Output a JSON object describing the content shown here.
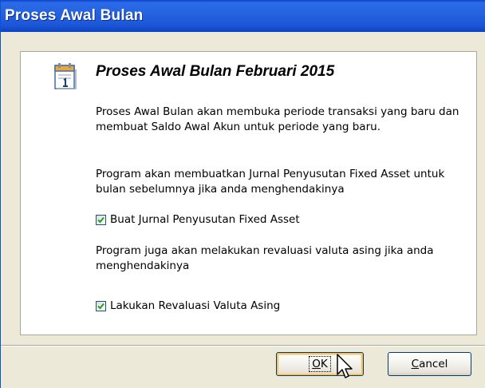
{
  "window": {
    "title": "Proses Awal Bulan"
  },
  "content": {
    "heading": "Proses Awal Bulan Februari 2015",
    "paragraph1": "Proses Awal Bulan akan membuka periode transaksi yang baru dan membuat Saldo Awal Akun untuk periode yang baru.",
    "paragraph2": "Program akan membuatkan Jurnal Penyusutan Fixed Asset untuk bulan sebelumnya jika anda menghendakinya",
    "checkbox1": {
      "label": "Buat Jurnal Penyusutan Fixed Asset",
      "checked": true
    },
    "paragraph3": "Program juga akan melakukan revaluasi valuta asing jika anda menghendakinya",
    "checkbox2": {
      "label": "Lakukan Revaluasi Valuta Asing",
      "checked": true
    }
  },
  "buttons": {
    "ok": {
      "mnemonic": "O",
      "rest": "K"
    },
    "cancel": {
      "mnemonic": "C",
      "rest": "ancel"
    }
  },
  "icons": {
    "document": "calendar-document-icon",
    "cursor": "mouse-pointer-icon",
    "check": "checkmark-icon"
  },
  "colors": {
    "titlebar": "#2563e0",
    "dialog_bg": "#ece9d8",
    "checkmark": "#21a121",
    "ok_focus": "#f3c36a"
  }
}
